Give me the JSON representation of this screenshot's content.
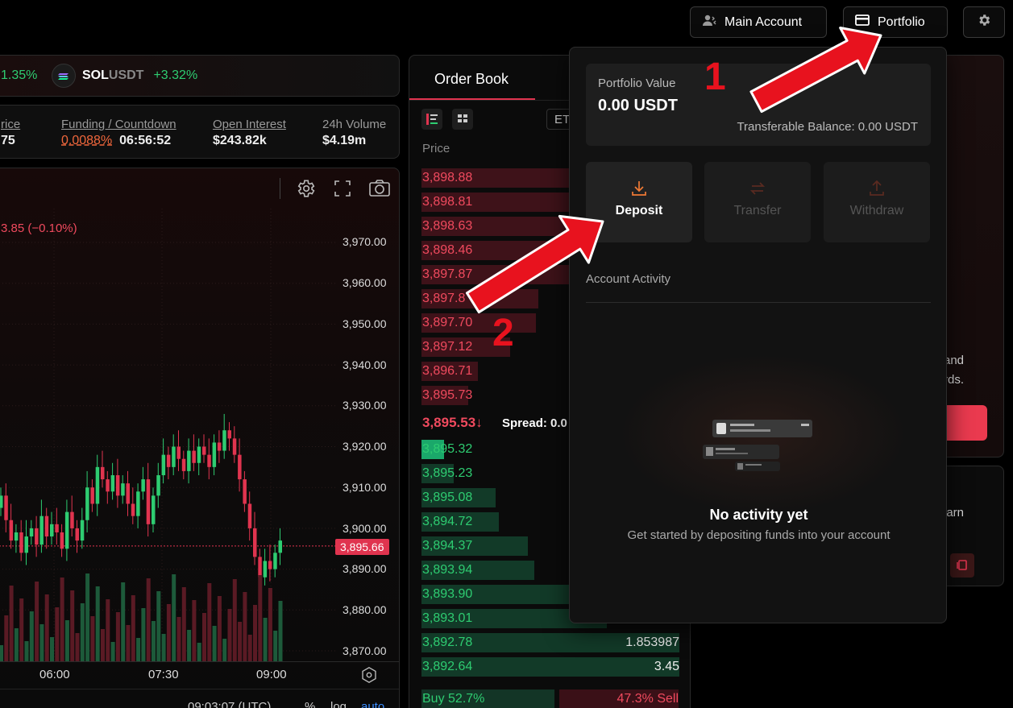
{
  "header": {
    "main_account_label": "Main Account",
    "portfolio_label": "Portfolio"
  },
  "ticker": {
    "prev_change": "1.35%",
    "sol_base": "SOL",
    "sol_quote": "USDT",
    "sol_change": "+3.32%"
  },
  "stats": {
    "price_label": "rice",
    "price_value": "75",
    "funding_label": "Funding / Countdown",
    "funding_rate": "0.0088%",
    "countdown": "06:56:52",
    "open_interest_label": "Open Interest",
    "open_interest_value": "$243.82k",
    "volume_label": "24h Volume",
    "volume_value": "$4.19m"
  },
  "chart": {
    "change_text": "3.85 (−0.10%)",
    "y_ticks": [
      "3,970.00",
      "3,960.00",
      "3,950.00",
      "3,940.00",
      "3,930.00",
      "3,920.00",
      "3,910.00",
      "3,900.00",
      "3,890.00",
      "3,880.00",
      "3,870.00"
    ],
    "current_price_tag": "3,895.66",
    "x_ticks": [
      "06:00",
      "07:30",
      "09:00"
    ],
    "footer_time": "09:03:07 (UTC)",
    "footer_percent": "%",
    "footer_log": "log",
    "footer_auto": "auto",
    "icons": [
      "gear-icon",
      "fullscreen-icon",
      "camera-icon",
      "target-icon"
    ]
  },
  "chart_data": {
    "type": "candlestick",
    "y_axis_range": [
      3865,
      3975
    ],
    "x_ticks": [
      "06:00",
      "07:30",
      "09:00"
    ],
    "last_price": 3895.66,
    "volume_bars": true
  },
  "order_book": {
    "tab_label": "Order Book",
    "selector_label": "ET",
    "column_price": "Price",
    "asks": [
      "3,898.88",
      "3,898.81",
      "3,898.63",
      "3,898.46",
      "3,897.87",
      "3,897.8",
      "3,897.70",
      "3,897.12",
      "3,896.71",
      "3,895.73"
    ],
    "mid_price": "3,895.53",
    "mid_arrow": "↓",
    "spread_label": "Spread: 0.0",
    "bids": [
      "3,895.32",
      "3,895.23",
      "3,895.08",
      "3,894.72",
      "3,894.37",
      "3,893.94",
      "3,893.90",
      "3,893.01",
      "3,892.78",
      "3,892.64"
    ],
    "bid_sizes_visible": {
      "3,892.78": "1.853987",
      "3,892.64": "3.45"
    },
    "buy_pct": "Buy 52.7%",
    "sell_pct": "47.3% Sell"
  },
  "portfolio_dropdown": {
    "value_label": "Portfolio Value",
    "value": "0.00 USDT",
    "transferable": "Transferable Balance: 0.00 USDT",
    "deposit_label": "Deposit",
    "transfer_label": "Transfer",
    "withdraw_label": "Withdraw",
    "activity_label": "Account Activity",
    "empty_title": "No activity yet",
    "empty_sub": "Get started by depositing funds into your account"
  },
  "right_panel": {
    "text1": "and",
    "text2": "rds.",
    "text3": ". Earn"
  },
  "annotations": {
    "arrow1_label": "1",
    "arrow2_label": "2",
    "color": "#e8121e"
  }
}
